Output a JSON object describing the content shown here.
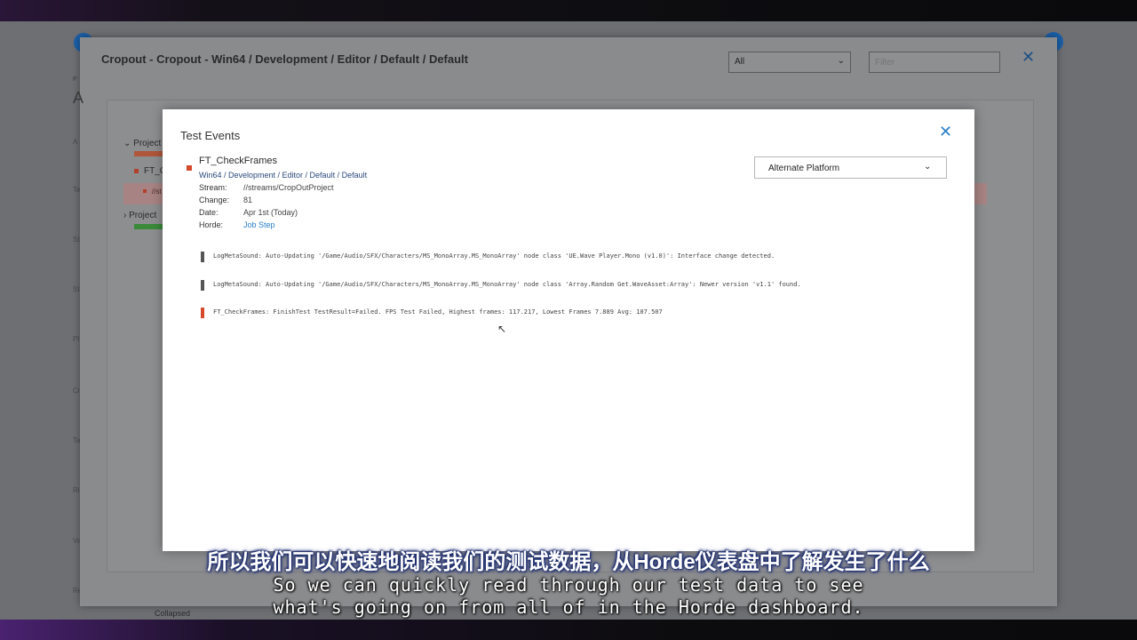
{
  "backdrop": {
    "left_letters": [
      "A",
      "Te",
      "St",
      "St",
      "Pl",
      "Cr",
      "Ta",
      "Ri",
      "Va",
      "Re"
    ]
  },
  "outer_dialog": {
    "title": "Cropout - Cropout - Win64 / Development / Editor / Default / Default",
    "select_value": "All",
    "filter_placeholder": "Filter",
    "close_icon": "close-icon",
    "small_p": "P",
    "big_a": "A",
    "tree": {
      "project_1": "Project",
      "ft_item": "FT_C",
      "sub_item": "//st",
      "project_2": "Project"
    },
    "collapsed_label": "Collapsed"
  },
  "modal": {
    "title": "Test Events",
    "close_icon": "close-icon",
    "test": {
      "name": "FT_CheckFrames",
      "path": "Win64 / Development / Editor / Default / Default",
      "status_color": "#d64a2c"
    },
    "meta": [
      {
        "label": "Stream:",
        "value": "//streams/CropOutProject"
      },
      {
        "label": "Change:",
        "value": "81"
      },
      {
        "label": "Date:",
        "value": "Apr 1st (Today)"
      },
      {
        "label": "Horde:",
        "value": "Job Step",
        "link": true
      }
    ],
    "platform_select": {
      "value": "Alternate Platform",
      "icon": "chevron-down-icon"
    },
    "logs": [
      {
        "level": "warning",
        "color": "#555555",
        "text": "LogMetaSound: Auto-Updating '/Game/Audio/SFX/Characters/MS_MonoArray.MS_MonoArray' node class 'UE.Wave Player.Mono (v1.0)': Interface change detected."
      },
      {
        "level": "warning",
        "color": "#555555",
        "text": "LogMetaSound: Auto-Updating '/Game/Audio/SFX/Characters/MS_MonoArray.MS_MonoArray' node class 'Array.Random Get.WaveAsset:Array': Newer version 'v1.1' found."
      },
      {
        "level": "error",
        "color": "#d64a2c",
        "text": "FT_CheckFrames: FinishTest TestResult=Failed. FPS Test Failed, Highest frames: 117.217, Lowest Frames 7.889 Avg: 107.507"
      }
    ]
  },
  "subtitles": {
    "zh": "所以我们可以快速地阅读我们的测试数据，从Horde仪表盘中了解发生了什么",
    "en_line1": "So we can quickly read through our test data to see",
    "en_line2": "what's going on from all of in the Horde dashboard."
  },
  "colors": {
    "accent_blue": "#2a7fc8",
    "error_red": "#d64a2c",
    "success_green": "#3aa63a"
  }
}
